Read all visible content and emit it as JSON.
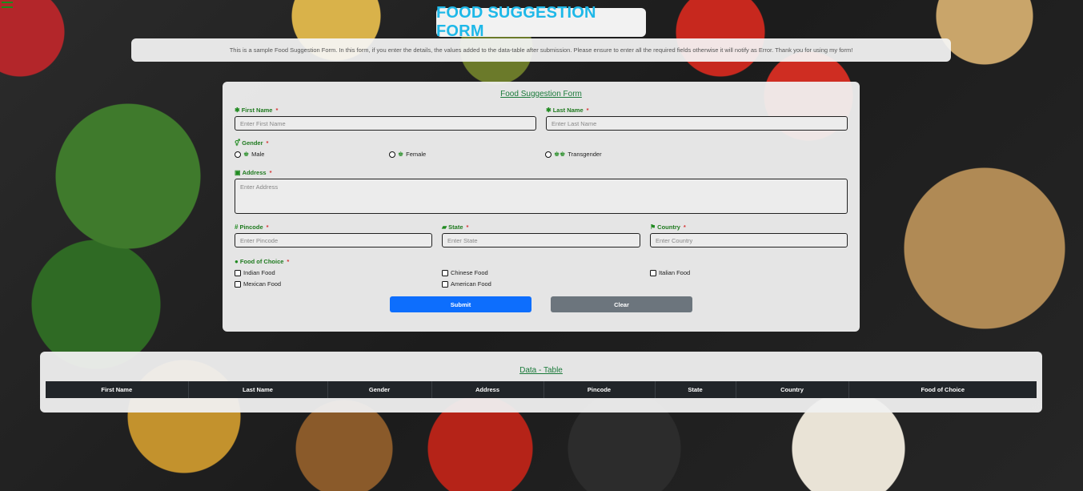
{
  "header": {
    "title": "FOOD SUGGESTION FORM",
    "description": "This is a sample Food Suggestion Form. In this form, if you enter the details, the values added to the data-table after submission. Please ensure to enter all the required fields otherwise it will notify as Error. Thank you for using my form!"
  },
  "form": {
    "title": "Food Suggestion Form",
    "required_marker": "*",
    "first_name": {
      "label": "First Name",
      "placeholder": "Enter First Name",
      "value": ""
    },
    "last_name": {
      "label": "Last Name",
      "placeholder": "Enter Last Name",
      "value": ""
    },
    "gender": {
      "label": "Gender",
      "options": [
        "Male",
        "Female",
        "Transgender"
      ],
      "selected": ""
    },
    "address": {
      "label": "Address",
      "placeholder": "Enter Address",
      "value": ""
    },
    "pincode": {
      "label": "Pincode",
      "placeholder": "Enter Pincode",
      "value": ""
    },
    "state": {
      "label": "State",
      "placeholder": "Enter State",
      "value": ""
    },
    "country": {
      "label": "Country",
      "placeholder": "Enter Country",
      "value": ""
    },
    "food": {
      "label": "Food of Choice",
      "options": [
        "Indian Food",
        "Chinese Food",
        "Italian Food",
        "Mexican Food",
        "American Food"
      ],
      "checked": []
    },
    "submit_label": "Submit",
    "clear_label": "Clear"
  },
  "table": {
    "title": "Data - Table",
    "columns": [
      "First Name",
      "Last Name",
      "Gender",
      "Address",
      "Pincode",
      "State",
      "Country",
      "Food of Choice"
    ],
    "rows": []
  },
  "icons": {
    "first_name": "gear-icon",
    "last_name": "gear-icon",
    "gender": "gender-icon",
    "address": "address-card-icon",
    "pincode": "hash-icon",
    "state": "map-icon",
    "country": "flag-icon",
    "food": "food-icon"
  },
  "colors": {
    "title": "#1eb8e8",
    "label": "#1f7a1f",
    "required": "#d63333",
    "submit": "#0d6efd",
    "clear": "#6c757d",
    "table_header": "#212529"
  }
}
